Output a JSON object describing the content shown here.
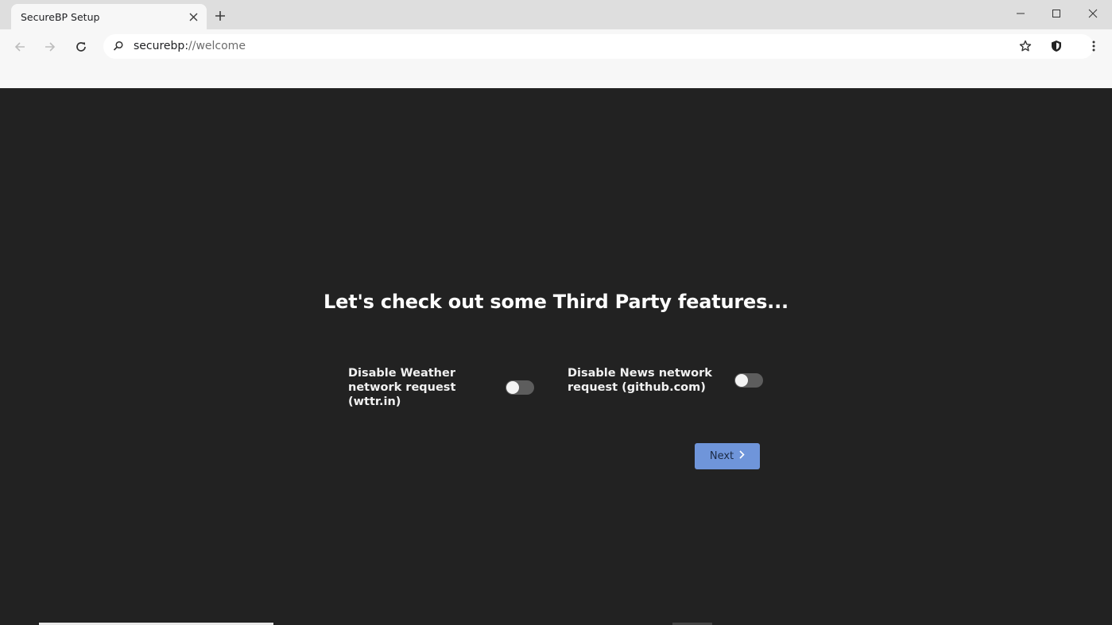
{
  "tab": {
    "title": "SecureBP Setup"
  },
  "address_bar": {
    "host": "securebp:",
    "rest": "//welcome"
  },
  "setup": {
    "heading": "Let's check out some Third Party features...",
    "options": [
      {
        "label": "Disable Weather network request (wttr.in)",
        "enabled": false
      },
      {
        "label": "Disable News network request (github.com)",
        "enabled": false
      }
    ],
    "next_label": "Next"
  },
  "colors": {
    "page_background": "#222222",
    "button_background": "#6f95da",
    "toggle_off": "#5d5d5d"
  },
  "icons": [
    "close-icon",
    "plus-icon",
    "minimize-icon",
    "maximize-icon",
    "window-close-icon",
    "back-arrow-icon",
    "forward-arrow-icon",
    "reload-icon",
    "search-icon",
    "star-icon",
    "shield-icon",
    "more-vert-icon",
    "chevron-right-icon"
  ]
}
